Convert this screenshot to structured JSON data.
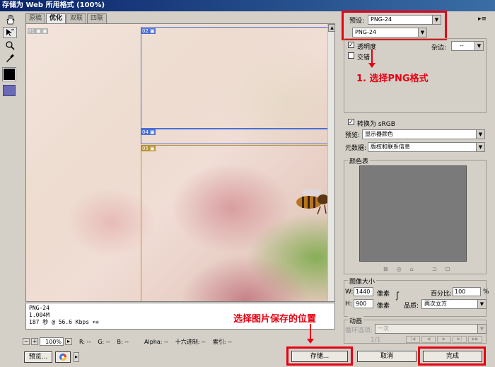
{
  "window": {
    "title": "存储为 Web 所用格式 (100%)"
  },
  "tools": [
    "hand-tool",
    "slice-select-tool",
    "zoom-tool",
    "eyedropper-tool"
  ],
  "tabs": [
    {
      "label": "原稿",
      "active": false
    },
    {
      "label": "优化",
      "active": true
    },
    {
      "label": "双联",
      "active": false
    },
    {
      "label": "四联",
      "active": false
    }
  ],
  "slices": [
    {
      "id": "01"
    },
    {
      "id": "02"
    },
    {
      "id": "04"
    },
    {
      "id": "05"
    }
  ],
  "info": {
    "format": "PNG-24",
    "size": "1.004M",
    "time": "187 秒 @ 56.6 Kbps"
  },
  "status": {
    "zoom": "100%",
    "r": "R: --",
    "g": "G: --",
    "b": "B: --",
    "alpha": "Alpha: --",
    "hex": "十六进制: --",
    "index": "索引: --"
  },
  "buttons": {
    "preview": "预览...",
    "save": "存储...",
    "cancel": "取消",
    "done": "完成"
  },
  "settings": {
    "preset_label": "预设:",
    "preset_value": "PNG-24",
    "format_value": "PNG-24",
    "transparency": "透明度",
    "matte_label": "杂边:",
    "matte_value": "--",
    "interlaced": "交错",
    "srgb": "转换为 sRGB",
    "preview_label": "预览:",
    "preview_value": "显示器颜色",
    "metadata_label": "元数据:",
    "metadata_value": "版权和联系信息",
    "color_table": "颜色表"
  },
  "image_size": {
    "title": "图像大小",
    "w_label": "W:",
    "w_value": "1440",
    "h_label": "H:",
    "h_value": "900",
    "unit": "像素",
    "percent_label": "百分比:",
    "percent_value": "100",
    "percent_sign": "%",
    "quality_label": "品质:",
    "quality_value": "两次立方"
  },
  "animation": {
    "title": "动画",
    "loop_label": "循环选项:",
    "loop_value": "一次",
    "frame": "1/1"
  },
  "annotations": {
    "step1": "1. 选择PNG格式",
    "step2": "选择图片保存的位置"
  },
  "colors": {
    "annotation": "#e60012",
    "slice_blue": "#4a6fd6",
    "slice_gold": "#b8922e"
  }
}
